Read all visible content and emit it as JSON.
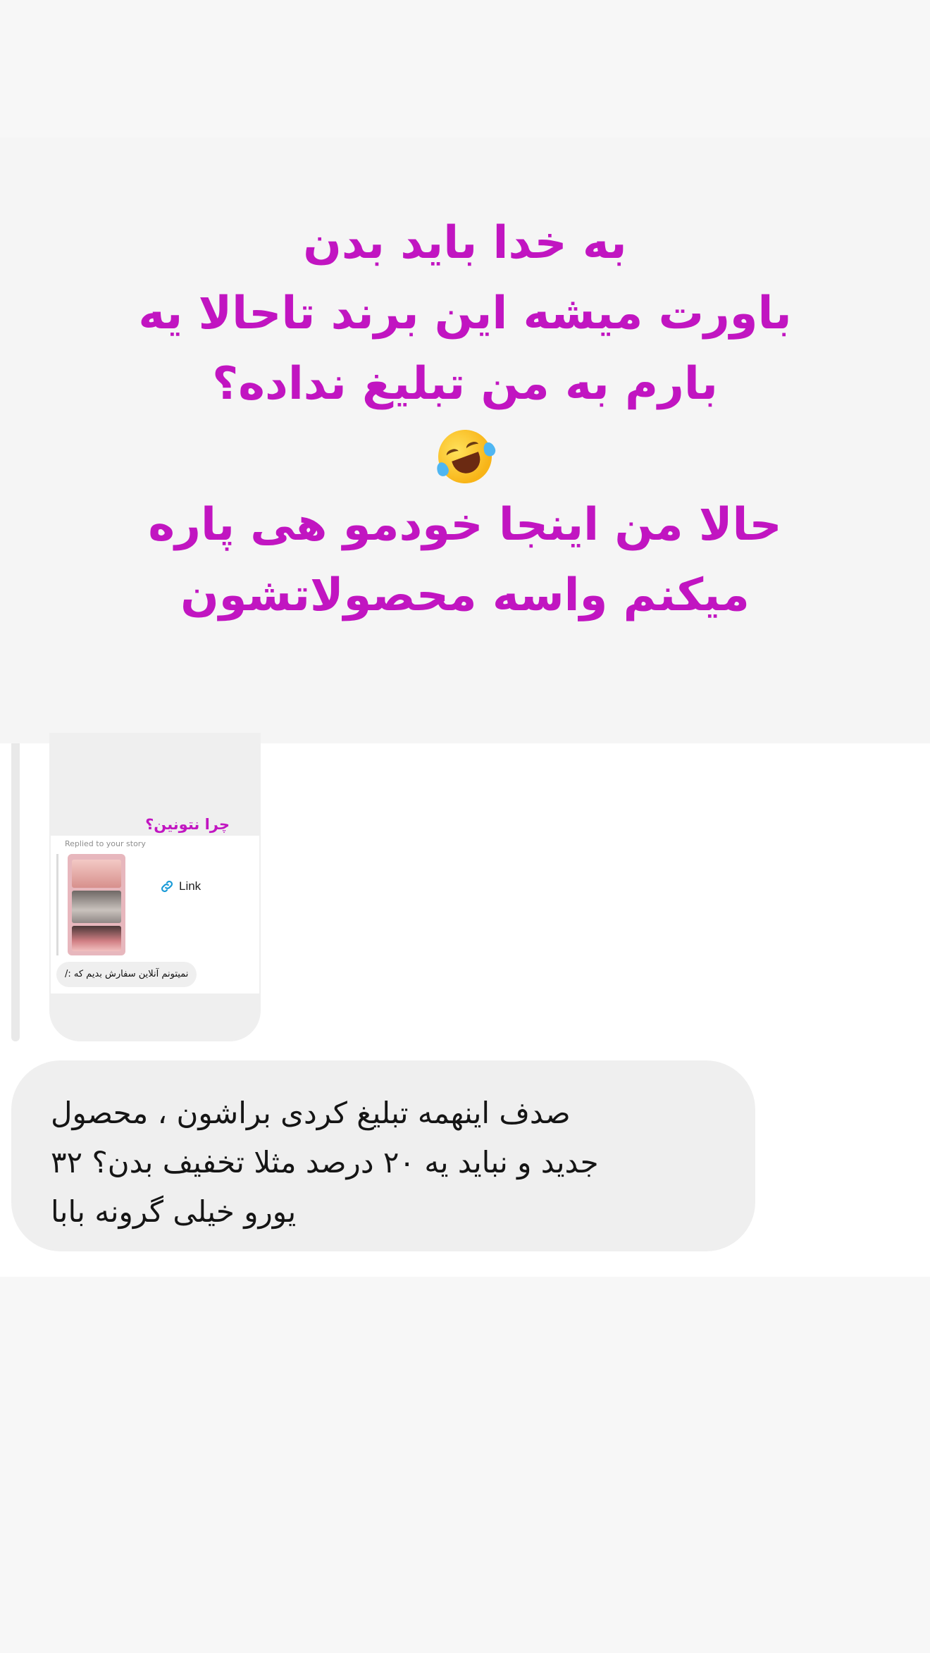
{
  "story_overlay": {
    "lines": [
      "به خدا باید بدن",
      "باورت میشه این برند تاحالا یه",
      "بارم به من تبلیغ نداده؟",
      "حالا من اینجا خودمو هی پاره",
      "میکنم واسه محصولاتشون"
    ],
    "emoji": "rolling-on-the-floor-laughing"
  },
  "story_reply": {
    "caption": "چرا نتونین؟",
    "replied_label": "Replied to your story",
    "link_label": "Link",
    "reply_text": "نمیتونم آنلاین سفارش بدیم که :/"
  },
  "message": {
    "lines": [
      "صدف اینهمه تبلیغ کردی براشون ، محصول",
      "جدید و نباید یه ۲۰ درصد مثلا تخفیف بدن؟ ۳۲",
      "یورو خیلی گرونه بابا"
    ]
  },
  "colors": {
    "overlay_text": "#c115c1",
    "bubble_bg": "#efefef",
    "page_bg": "#f7f7f7"
  }
}
